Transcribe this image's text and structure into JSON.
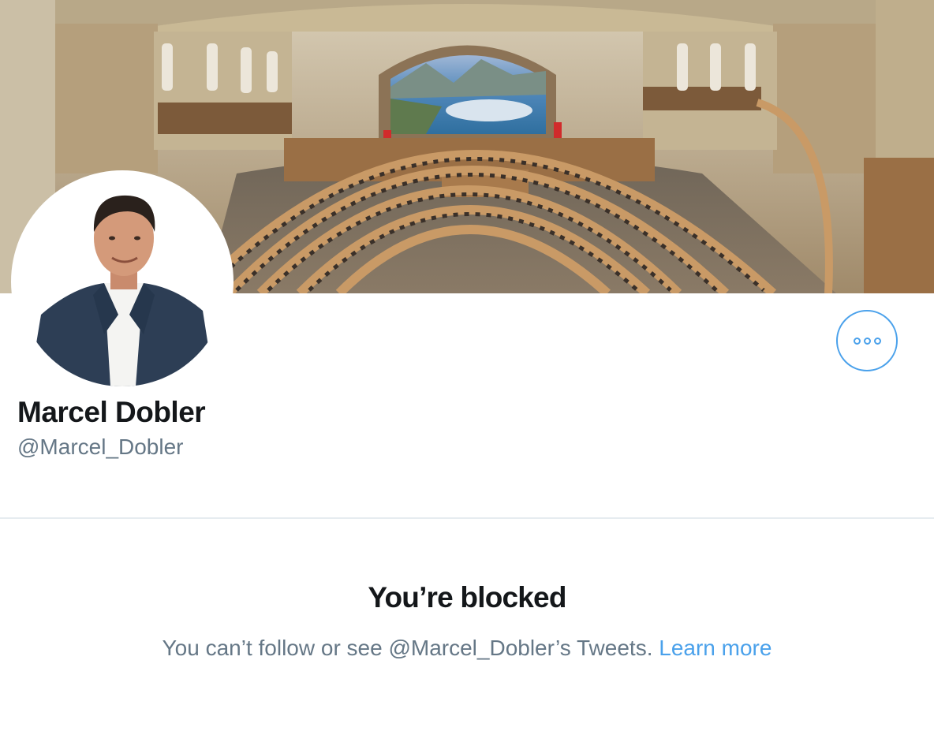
{
  "profile": {
    "name": "Marcel Dobler",
    "handle": "@Marcel_Dobler"
  },
  "blocked": {
    "title": "You’re blocked",
    "message": "You can’t follow or see @Marcel_Dobler’s Tweets.",
    "learn_more": "Learn more"
  },
  "icons": {
    "more": "more-options-icon"
  },
  "colors": {
    "accent": "#4aa1eb",
    "secondary_text": "#657786",
    "divider": "#e6ecf0"
  }
}
